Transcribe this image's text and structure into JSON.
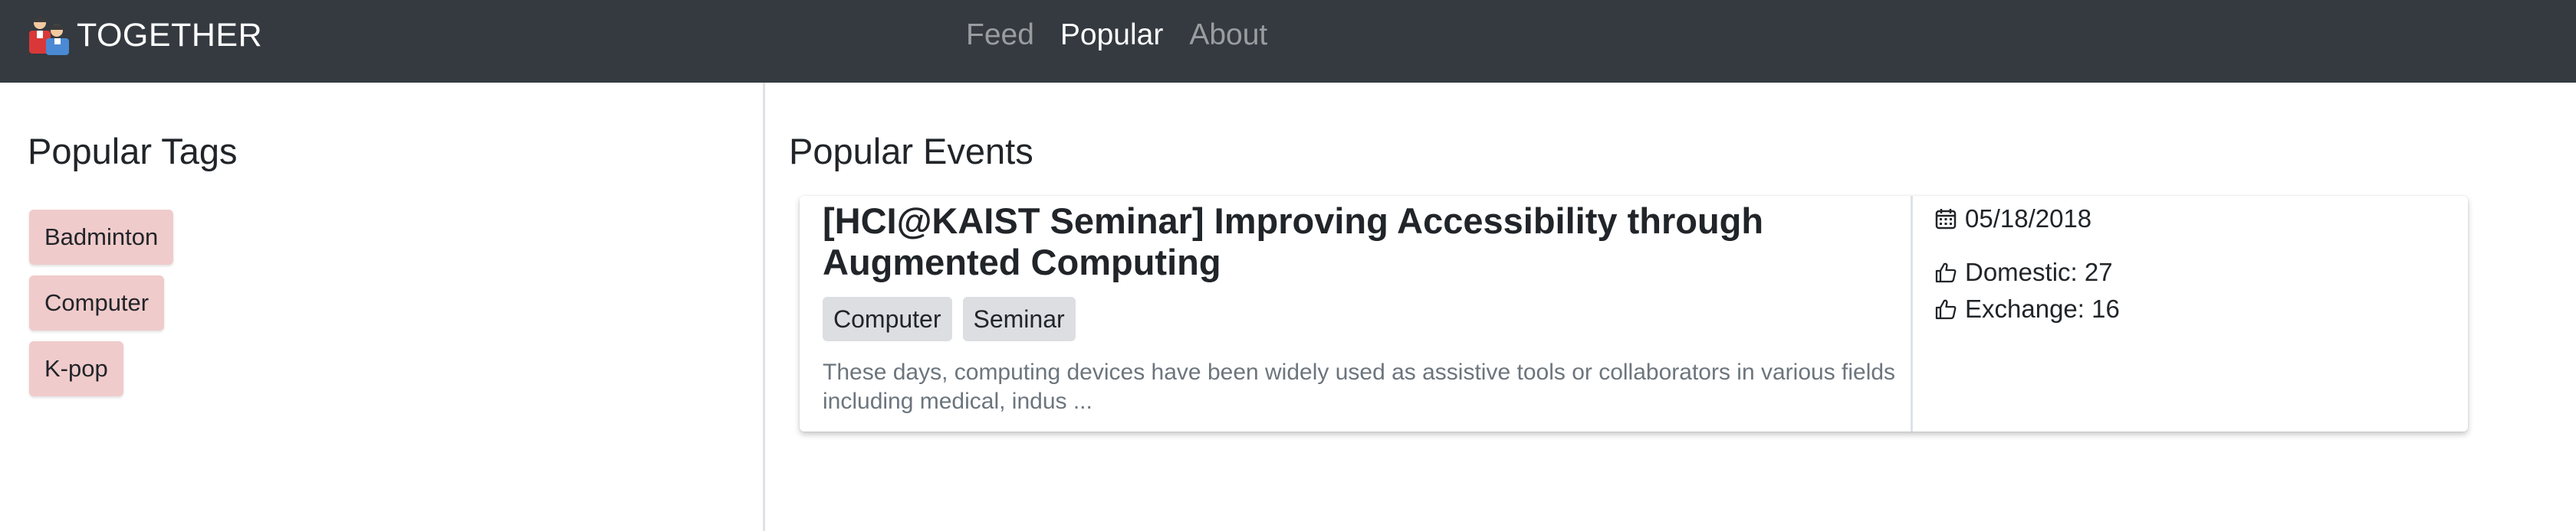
{
  "navbar": {
    "brand": {
      "logo_icon": "people-logo-icon",
      "name": "TOGETHER"
    },
    "links": [
      {
        "label": "Feed",
        "active": false
      },
      {
        "label": "Popular",
        "active": true
      },
      {
        "label": "About",
        "active": false
      }
    ],
    "background_color": "#343a40"
  },
  "popular_tags": {
    "title": "Popular Tags",
    "tag_color": "#f0cbcb",
    "tags": [
      "Badminton",
      "Computer",
      "K-pop"
    ]
  },
  "popular_events": {
    "title": "Popular Events",
    "events": [
      {
        "title": "[HCI@KAIST Seminar] Improving Accessibility through Augmented Computing",
        "tags": [
          "Computer",
          "Seminar"
        ],
        "description": "These days, computing devices have been widely used as assistive tools or collaborators in various fields including medical, indus ...",
        "date_icon": "calendar-icon",
        "date": "05/18/2018",
        "likes_icon": "thumbs-up-icon",
        "domestic": "Domestic: 27",
        "exchange": "Exchange: 16"
      }
    ]
  }
}
